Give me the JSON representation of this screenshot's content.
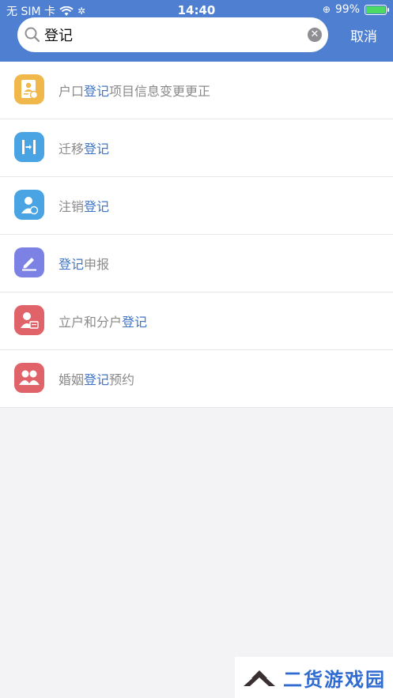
{
  "status_bar": {
    "carrier": "无 SIM 卡",
    "time": "14:40",
    "battery": "99%"
  },
  "search": {
    "value": "登记",
    "cancel_label": "取消"
  },
  "results": [
    {
      "pre": "户口",
      "hl": "登记",
      "post": "项目信息变更更正",
      "icon": "household-register-icon",
      "color": "#f0b74a"
    },
    {
      "pre": "迁移",
      "hl": "登记",
      "post": "",
      "icon": "migration-icon",
      "color": "#4aa3e3"
    },
    {
      "pre": "注销",
      "hl": "登记",
      "post": "",
      "icon": "cancel-user-icon",
      "color": "#4aa3e3"
    },
    {
      "pre": "",
      "hl": "登记",
      "post": "申报",
      "icon": "edit-declare-icon",
      "color": "#7b82e3"
    },
    {
      "pre": "立户和分户",
      "hl": "登记",
      "post": "",
      "icon": "user-card-icon",
      "color": "#e0636a"
    },
    {
      "pre": "婚姻",
      "hl": "登记",
      "post": "预约",
      "icon": "marriage-icon",
      "color": "#e0636a"
    }
  ],
  "watermark": {
    "text": "二货游戏园"
  },
  "colors": {
    "header": "#4f7fd0",
    "highlight": "#3f74c7"
  }
}
